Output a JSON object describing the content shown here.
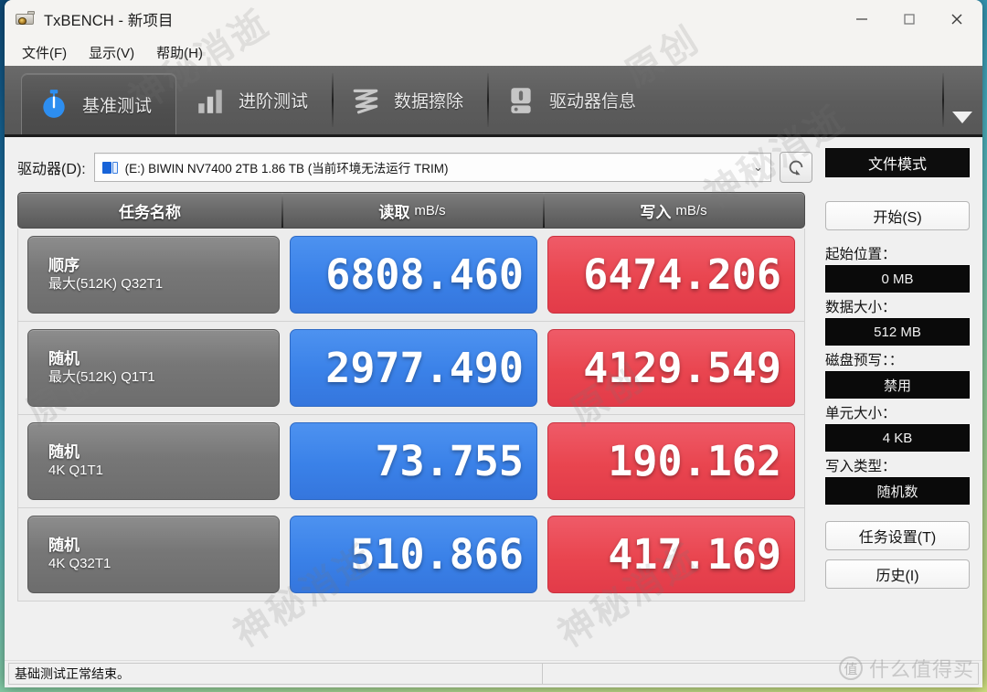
{
  "window": {
    "title": "TxBENCH - 新项目",
    "app_icon": "drive-meter-icon",
    "controls": {
      "minimize": "—",
      "maximize": "▢",
      "close": "✕"
    }
  },
  "menubar": {
    "items": [
      {
        "label": "文件(F)",
        "name": "menu-file"
      },
      {
        "label": "显示(V)",
        "name": "menu-view"
      },
      {
        "label": "帮助(H)",
        "name": "menu-help"
      }
    ]
  },
  "tabs": {
    "overflow_icon": "chevron-down-icon",
    "items": [
      {
        "label": "基准测试",
        "icon": "stopwatch-icon",
        "active": true
      },
      {
        "label": "进阶测试",
        "icon": "bar-chart-icon",
        "active": false
      },
      {
        "label": "数据擦除",
        "icon": "zigzag-erase-icon",
        "active": false
      },
      {
        "label": "驱动器信息",
        "icon": "hard-drive-icon",
        "active": false
      }
    ]
  },
  "drive": {
    "label": "驱动器(D):",
    "value": "(E:) BIWIN NV7400 2TB  1.86 TB (当前环境无法运行 TRIM)",
    "caret": "⌄",
    "refresh_icon": "refresh-icon"
  },
  "table": {
    "headers": {
      "task": "任务名称",
      "read": "读取",
      "read_unit": "mB/s",
      "write": "写入",
      "write_unit": "mB/s"
    },
    "rows": [
      {
        "title": "顺序",
        "detail": "最大(512K) Q32T1",
        "read": "6808.460",
        "write": "6474.206"
      },
      {
        "title": "随机",
        "detail": "最大(512K) Q1T1",
        "read": "2977.490",
        "write": "4129.549"
      },
      {
        "title": "随机",
        "detail": "4K Q1T1",
        "read": "73.755",
        "write": "190.162"
      },
      {
        "title": "随机",
        "detail": "4K Q32T1",
        "read": "510.866",
        "write": "417.169"
      }
    ]
  },
  "sidebar": {
    "file_mode": "文件模式",
    "start_button": "开始(S)",
    "start_pos_label": "起始位置：",
    "start_pos_value": "0 MB",
    "data_size_label": "数据大小：",
    "data_size_value": "512 MB",
    "prewrite_label": "磁盘预写：：",
    "prewrite_value": "禁用",
    "unit_size_label": "单元大小：",
    "unit_size_value": "4 KB",
    "write_type_label": "写入类型：",
    "write_type_value": "随机数",
    "task_settings": "任务设置(T)",
    "history": "历史(I)"
  },
  "statusbar": {
    "message": "基础测试正常结束。"
  },
  "watermarks": {
    "stamps": [
      "神秘消逝",
      "原创",
      "神秘消逝",
      "原创",
      "神秘消逝",
      "原创",
      "神秘消逝"
    ],
    "brand_mark": "值",
    "brand_text": "什么值得买"
  },
  "colors": {
    "read_accent": "#3a81e8",
    "write_accent": "#e9454f",
    "tab_active_icon": "#2d8ef0",
    "dark_field": "#0a0a0a"
  }
}
